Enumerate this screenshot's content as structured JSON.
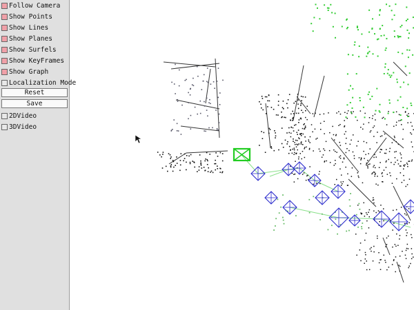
{
  "panel": {
    "checkboxes": [
      {
        "label": "Follow Camera",
        "checked": true
      },
      {
        "label": "Show Points",
        "checked": true
      },
      {
        "label": "Show Lines",
        "checked": true
      },
      {
        "label": "Show Planes",
        "checked": true
      },
      {
        "label": "Show Surfels",
        "checked": true
      },
      {
        "label": "Show KeyFrames",
        "checked": true
      },
      {
        "label": "Show Graph",
        "checked": true
      },
      {
        "label": "Localization Mode",
        "checked": false
      }
    ],
    "reset_label": "Reset",
    "save_label": "Save",
    "video_options": [
      {
        "label": "2DVideo",
        "checked": false
      },
      {
        "label": "3DVideo",
        "checked": false
      }
    ]
  },
  "colors": {
    "checked_box": "#f0a0a8",
    "keyframe": "#2a2acc",
    "current_camera": "#22cc22",
    "graph": "#88e088",
    "points": "#111111"
  }
}
